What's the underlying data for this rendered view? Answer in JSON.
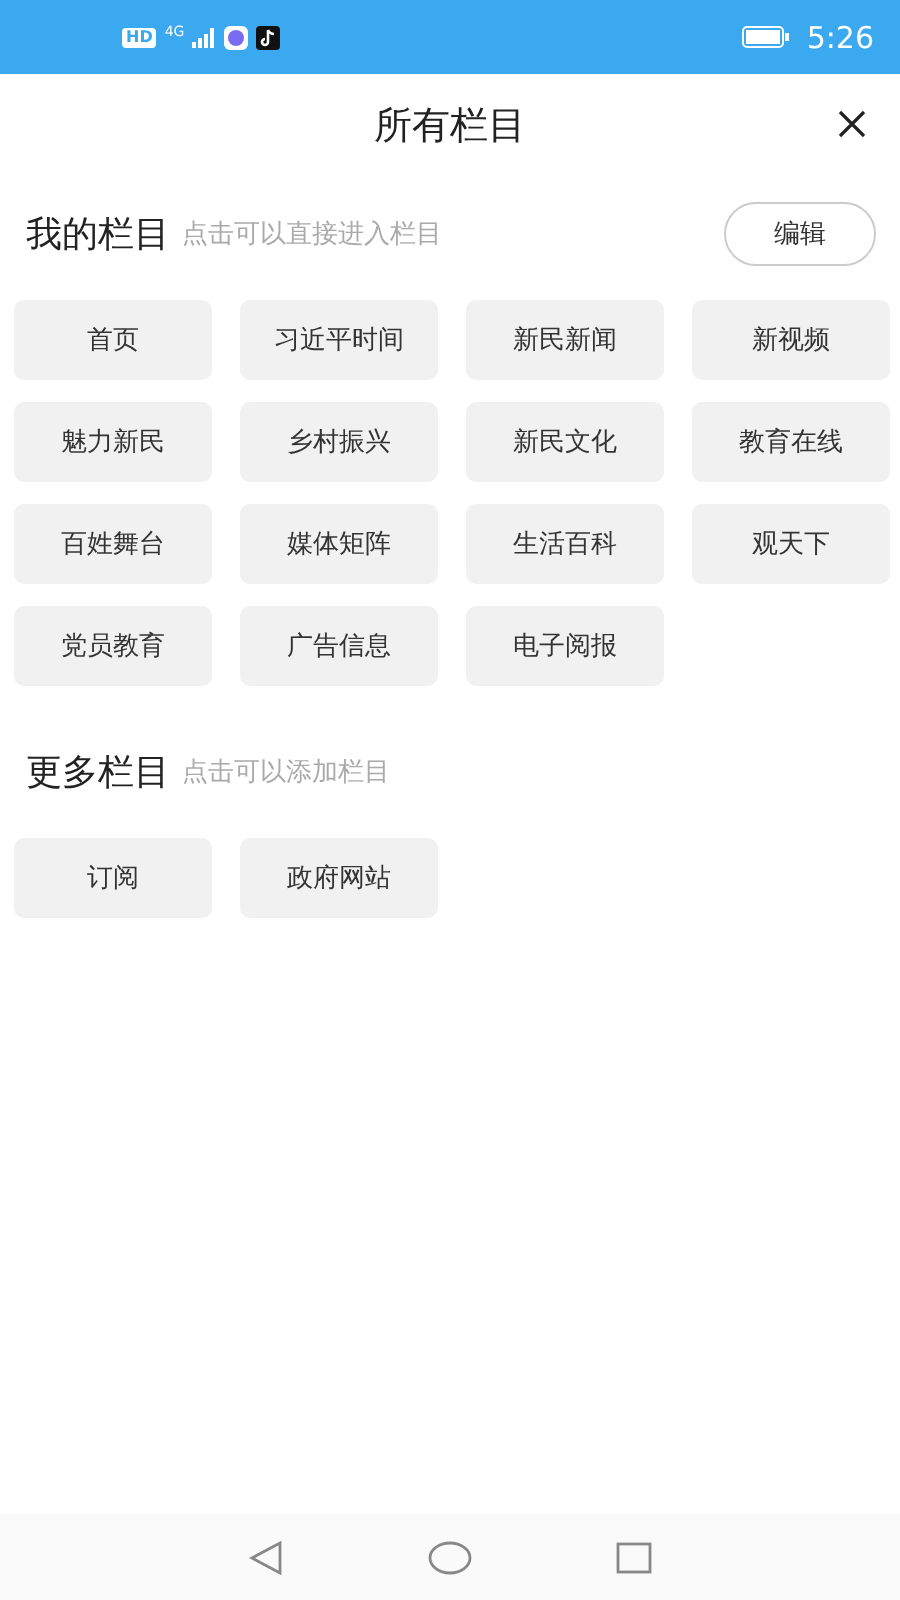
{
  "status_bar": {
    "hd": "HD",
    "network": "4G",
    "time": "5:26"
  },
  "header": {
    "title": "所有栏目"
  },
  "my_channels": {
    "title": "我的栏目",
    "hint": "点击可以直接进入栏目",
    "edit_button": "编辑",
    "items": [
      "首页",
      "习近平时间",
      "新民新闻",
      "新视频",
      "魅力新民",
      "乡村振兴",
      "新民文化",
      "教育在线",
      "百姓舞台",
      "媒体矩阵",
      "生活百科",
      "观天下",
      "党员教育",
      "广告信息",
      "电子阅报"
    ]
  },
  "more_channels": {
    "title": "更多栏目",
    "hint": "点击可以添加栏目",
    "items": [
      "订阅",
      "政府网站"
    ]
  }
}
